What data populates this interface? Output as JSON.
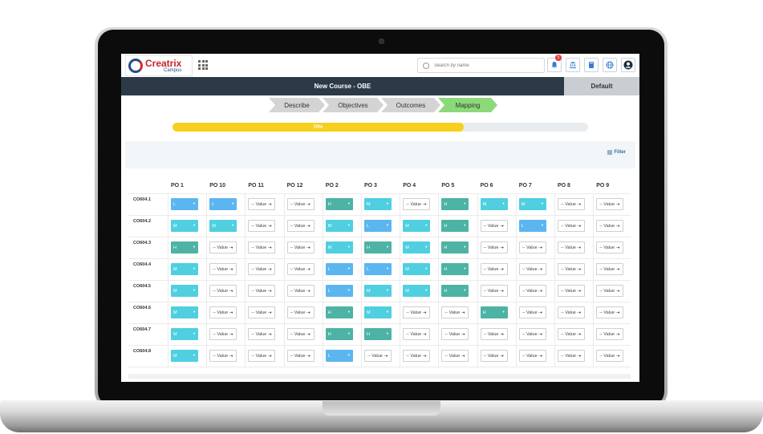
{
  "app": {
    "logo_name": "Creatrix",
    "logo_sub": "Campus",
    "search_placeholder": "Search by name",
    "notification_count": "5",
    "course_title": "New Course - OBE",
    "default_label": "Default"
  },
  "steps": [
    "Describe",
    "Objectives",
    "Outcomes",
    "Mapping"
  ],
  "active_step": "Mapping",
  "progress": {
    "percent": 70,
    "label": "70%"
  },
  "filter_label": "Filter",
  "colors": {
    "L": "#5bb6f0",
    "M": "#4fcfe0",
    "H": "#4db3a4",
    "empty": "#ffffff",
    "header": "#2c3a47",
    "progress": "#f7cf1c",
    "active_step": "#8cd97a"
  },
  "table": {
    "columns": [
      "PO 1",
      "PO 10",
      "PO 11",
      "PO 12",
      "PO 2",
      "PO 3",
      "PO 4",
      "PO 5",
      "PO 6",
      "PO 7",
      "PO 8",
      "PO 9"
    ],
    "empty_value": "-- Value --",
    "rows": [
      {
        "label": "CO604.1",
        "values": [
          "L",
          "L",
          "",
          "",
          "H",
          "M",
          "",
          "H",
          "M",
          "M",
          "",
          ""
        ]
      },
      {
        "label": "CO604.2",
        "values": [
          "M",
          "M",
          "",
          "",
          "M",
          "L",
          "M",
          "H",
          "",
          "L",
          "",
          ""
        ]
      },
      {
        "label": "CO604.3",
        "values": [
          "H",
          "",
          "",
          "",
          "M",
          "H",
          "M",
          "H",
          "",
          "",
          "",
          ""
        ]
      },
      {
        "label": "CO604.4",
        "values": [
          "M",
          "",
          "",
          "",
          "L",
          "L",
          "M",
          "H",
          "",
          "",
          "",
          ""
        ]
      },
      {
        "label": "CO604.5",
        "values": [
          "M",
          "",
          "",
          "",
          "L",
          "M",
          "M",
          "H",
          "",
          "",
          "",
          ""
        ]
      },
      {
        "label": "CO604.6",
        "values": [
          "M",
          "",
          "",
          "",
          "H",
          "M",
          "",
          "",
          "H",
          "",
          "",
          ""
        ]
      },
      {
        "label": "CO604.7",
        "values": [
          "M",
          "",
          "",
          "",
          "H",
          "H",
          "",
          "",
          "",
          "",
          "",
          ""
        ]
      },
      {
        "label": "CO604.8",
        "values": [
          "M",
          "",
          "",
          "",
          "L",
          "",
          "",
          "",
          "",
          "",
          "",
          ""
        ]
      }
    ]
  }
}
